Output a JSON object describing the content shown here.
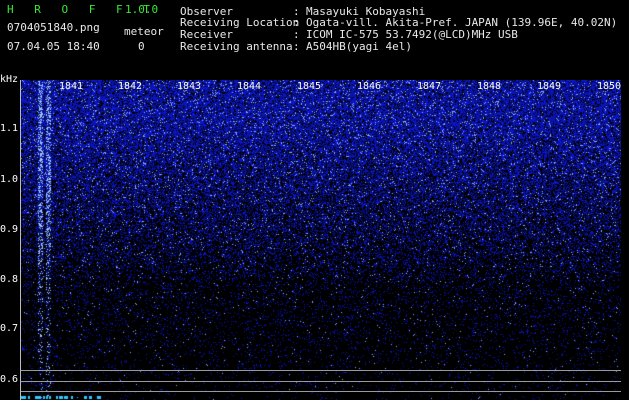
{
  "app": {
    "name": "H R O F F T",
    "version": "1.0.0"
  },
  "file": {
    "name": "0704051840.png",
    "datetime": "07.04.05 18:40"
  },
  "meteor": {
    "label": "meteor",
    "count": "0"
  },
  "info": {
    "rows": [
      {
        "label": "Observer",
        "sep": ":",
        "value": "Masayuki Kobayashi"
      },
      {
        "label": "Receiving Location",
        "sep": ":",
        "value": "Ogata-vill. Akita-Pref. JAPAN (139.96E, 40.02N)"
      },
      {
        "label": "Receiver",
        "sep": ":",
        "value": "ICOM IC-575 53.7492(@LCD)MHz USB"
      },
      {
        "label": "Receiving antenna",
        "sep": ":",
        "value": "A504HB(yagi 4el)"
      }
    ]
  },
  "spectrogram": {
    "y_unit": "kHz",
    "y_ticks": [
      "1.1",
      "1.0",
      "0.9",
      "0.8",
      "0.7",
      "0.6"
    ],
    "x_ticks": [
      "1841",
      "1842",
      "1843",
      "1844",
      "1845",
      "1846",
      "1847",
      "1848",
      "1849",
      "1850"
    ],
    "colors": {
      "background": "#000000",
      "noise": "#1c2cd8",
      "bright": "#c8d8ff"
    }
  }
}
